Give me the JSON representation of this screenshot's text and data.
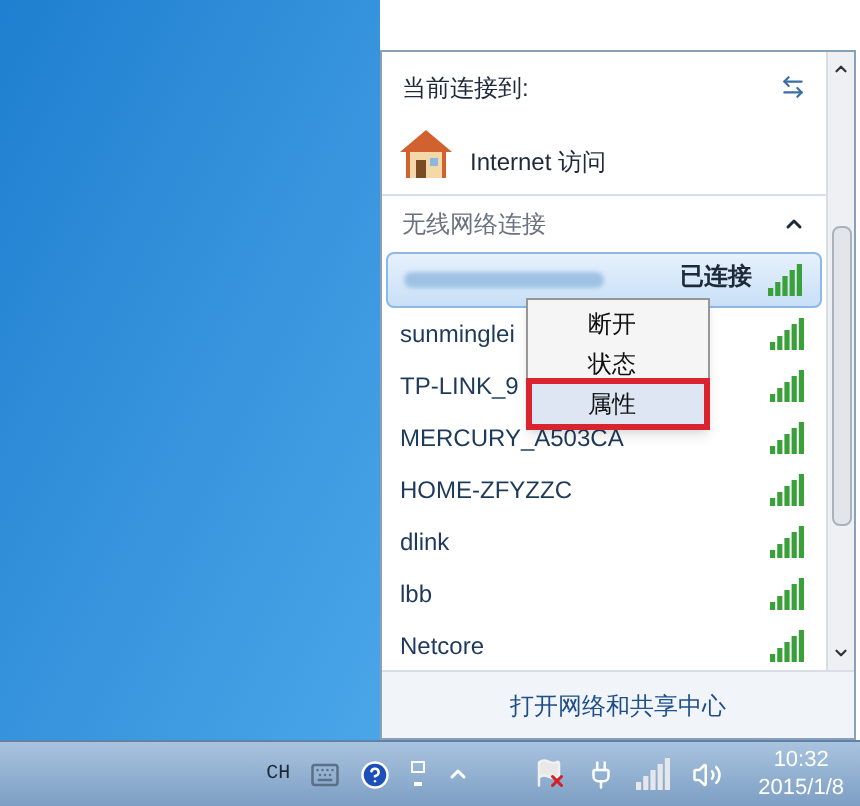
{
  "current": {
    "heading": "当前连接到:",
    "network": "Internet 访问"
  },
  "section": {
    "title": "无线网络连接",
    "expanded": true
  },
  "connected": {
    "status": "已连接",
    "selected": true
  },
  "networks": [
    {
      "name": "sunminglei"
    },
    {
      "name": "TP-LINK_9"
    },
    {
      "name": "MERCURY_A503CA"
    },
    {
      "name": "HOME-ZFYZZC"
    },
    {
      "name": "dlink"
    },
    {
      "name": "lbb"
    },
    {
      "name": "Netcore"
    }
  ],
  "context_menu": [
    {
      "label": "断开",
      "selected": false
    },
    {
      "label": "状态",
      "selected": false
    },
    {
      "label": "属性",
      "selected": true
    }
  ],
  "footer_link": "打开网络和共享中心",
  "taskbar": {
    "language": "CH",
    "time": "10:32",
    "date": "2015/1/8"
  }
}
